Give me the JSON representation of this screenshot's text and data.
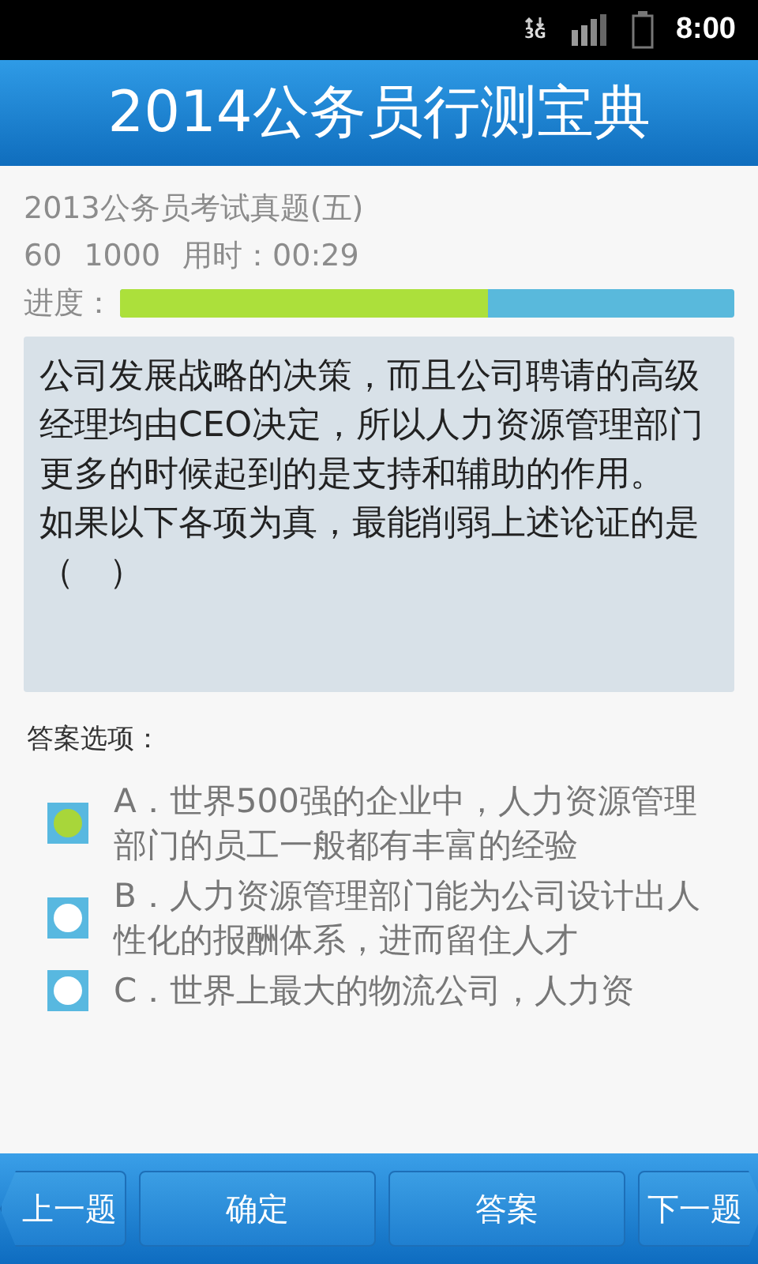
{
  "status_bar": {
    "network_type": "3G",
    "time": "8:00"
  },
  "header": {
    "title": "2014公务员行测宝典"
  },
  "exam": {
    "title": "2013公务员考试真题(五)",
    "stats": [
      "60",
      "1000",
      "用时：00:29"
    ],
    "progress_label": "进度：",
    "level": 0.6
  },
  "question": {
    "paragraphs": [
      "公司发展战略的决策，而且公司聘请的高级经理均由CEO决定，所以人力资源管理部门更多的时候起到的是支持和辅助的作用。",
      "如果以下各项为真，最能削弱上述论证的是（　）"
    ]
  },
  "options_label": "答案选项：",
  "options": [
    {
      "text": "A．世界500强的企业中，人力资源管理部门的员工一般都有丰富的经验",
      "selected": true
    },
    {
      "text": "B．人力资源管理部门能为公司设计出人性化的报酬体系，进而留住人才",
      "selected": false
    },
    {
      "text": "C．世界上最大的物流公司，人力资",
      "selected": false
    }
  ],
  "buttons": [
    {
      "label": "上一题",
      "kind": "prev"
    },
    {
      "label": "确定",
      "kind": "plain"
    },
    {
      "label": "答案",
      "kind": "plain"
    },
    {
      "label": "下一题",
      "kind": "next"
    }
  ]
}
